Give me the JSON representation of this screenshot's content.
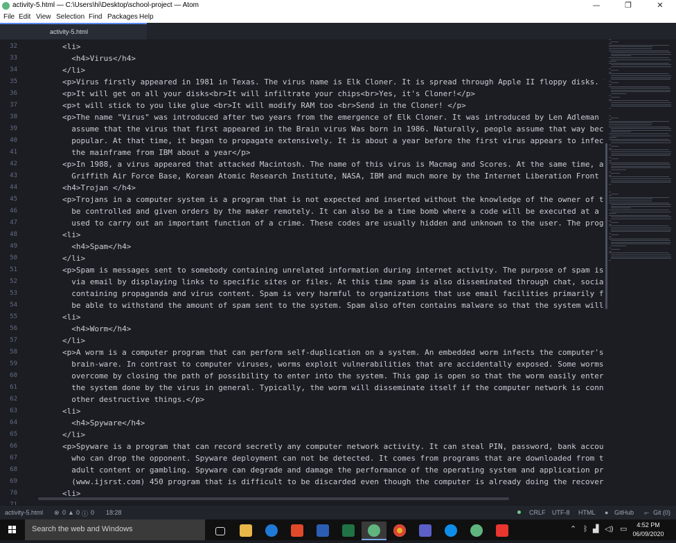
{
  "window": {
    "title": "activity-5.html — C:\\Users\\hi\\Desktop\\school-project — Atom",
    "minimize_glyph": "—",
    "restore_glyph": "❐",
    "close_glyph": "✕"
  },
  "menu": [
    "File",
    "Edit",
    "View",
    "Selection",
    "Find",
    "Packages",
    "Help"
  ],
  "tab": {
    "label": "activity-5.html"
  },
  "editor": {
    "line_numbers": [
      "32",
      "33",
      "34",
      "35",
      "36",
      "37",
      "38",
      "39",
      "40",
      "41",
      "42",
      "43",
      "44",
      "45",
      "46",
      "47",
      "48",
      "49",
      "50",
      "51",
      "52",
      "53",
      "54",
      "55",
      "56",
      "57",
      "58",
      "59",
      "60",
      "61",
      "62",
      "63",
      "64",
      "65",
      "66",
      "67",
      "68",
      "69",
      "70",
      "71"
    ],
    "lines": [
      "<li>",
      "  <h4>Virus</h4>",
      "</li>",
      "<p>Virus firstly appeared in 1981 in Texas. The virus name is Elk Cloner. It is spread through Apple II floppy disks. This v",
      "<p>It will get on all your disks<br>It will infiltrate your chips<br>Yes, it's Cloner!</p>",
      "<p>t will stick to you like glue <br>It will modify RAM too <br>Send in the Cloner! </p>",
      "<p>The name \"Virus\" was introduced after two years from the emergence of Elk Cloner. It was introduced by Len Adleman in Nov",
      "  assume that the virus that first appeared in the Brain virus Was born in 1986. Naturally, people assume that way because t",
      "  popular. At that time, it began to propagate extensively. It is about a year before the first virus appears to infect file",
      "  the mainframe from IBM about a year</p>",
      "<p>In 1988, a virus appeared that attacked Macintosh. The name of this virus is Macmag and Scores. At the same time, an inte",
      "  Griffith Air Force Base, Korean Atomic Research Institute, NASA, IBM and much more by the Internet Liberation Front on Tha",
      "<h4>Trojan </h4>",
      "<p>Trojans in a computer system is a program that is not expected and inserted without the knowledge of the owner of the equ",
      "  be controlled and given orders by the maker remotely. It can also be a time bomb where a code will be executed at a certai",
      "  used to carry out an important function of a crime. These codes are usually hidden and unknown to the user. The program pe",
      "<li>",
      "  <h4>Spam</h4>",
      "</li>",
      "<p>Spam is messages sent to somebody containing unrelated information during internet activity. The purpose of spam is to ad",
      "  via email by displaying links to specific sites or files. At this time spam is also disseminated through chat, social medi",
      "  containing propaganda and virus content. Spam is very harmful to organizations that use email facilities primarily for mil",
      "  be able to withstand the amount of spam sent to the system. Spam also often contains malware so that the system will send",
      "<li>",
      "  <h4>Worm</h4>",
      "</li>",
      "<p>A worm is a computer program that can perform self-duplication on a system. An embedded worm infects the computer's regis",
      "  brain-ware. In contrast to computer viruses, worms exploit vulnerabilities that are accidentally exposed. Some worms also",
      "  overcome by closing the path of possibility to enter into the system. This gap is open so that the worm easily enters and",
      "  the system done by the virus in general. Typically, the worm will disseminate itself if the computer network is connected",
      "  other destructive things.</p>",
      "<li>",
      "  <h4>Spyware</h4>",
      "</li>",
      "<p>Spyware is a program that can record secretly any computer network activity. It can steal PIN, password, bank account and",
      "  who can drop the opponent. Spyware deployment can not be detected. It comes from programs that are downloaded from the int",
      "  adult content or gambling. Spyware can degrade and damage the performance of the operating system and application programs",
      "  (www.ijsrst.com) 450 program that is difficult to be discarded even though the computer is already doing the recovery proc",
      "<li>",
      ""
    ]
  },
  "status": {
    "file": "activity-5.html",
    "errors": "0",
    "warnings": "0",
    "infos": "0",
    "cursor": "18:28",
    "line_ending": "CRLF",
    "encoding": "UTF-8",
    "grammar": "HTML",
    "github": "GitHub",
    "git": "Git (0)"
  },
  "taskbar": {
    "search_placeholder": "Search the web and Windows",
    "time": "4:52 PM",
    "date": "06/09/2020"
  },
  "colors": {
    "editor_bg": "#1b1d23",
    "tab_accent": "#568af2",
    "status_ok": "#73c990"
  }
}
